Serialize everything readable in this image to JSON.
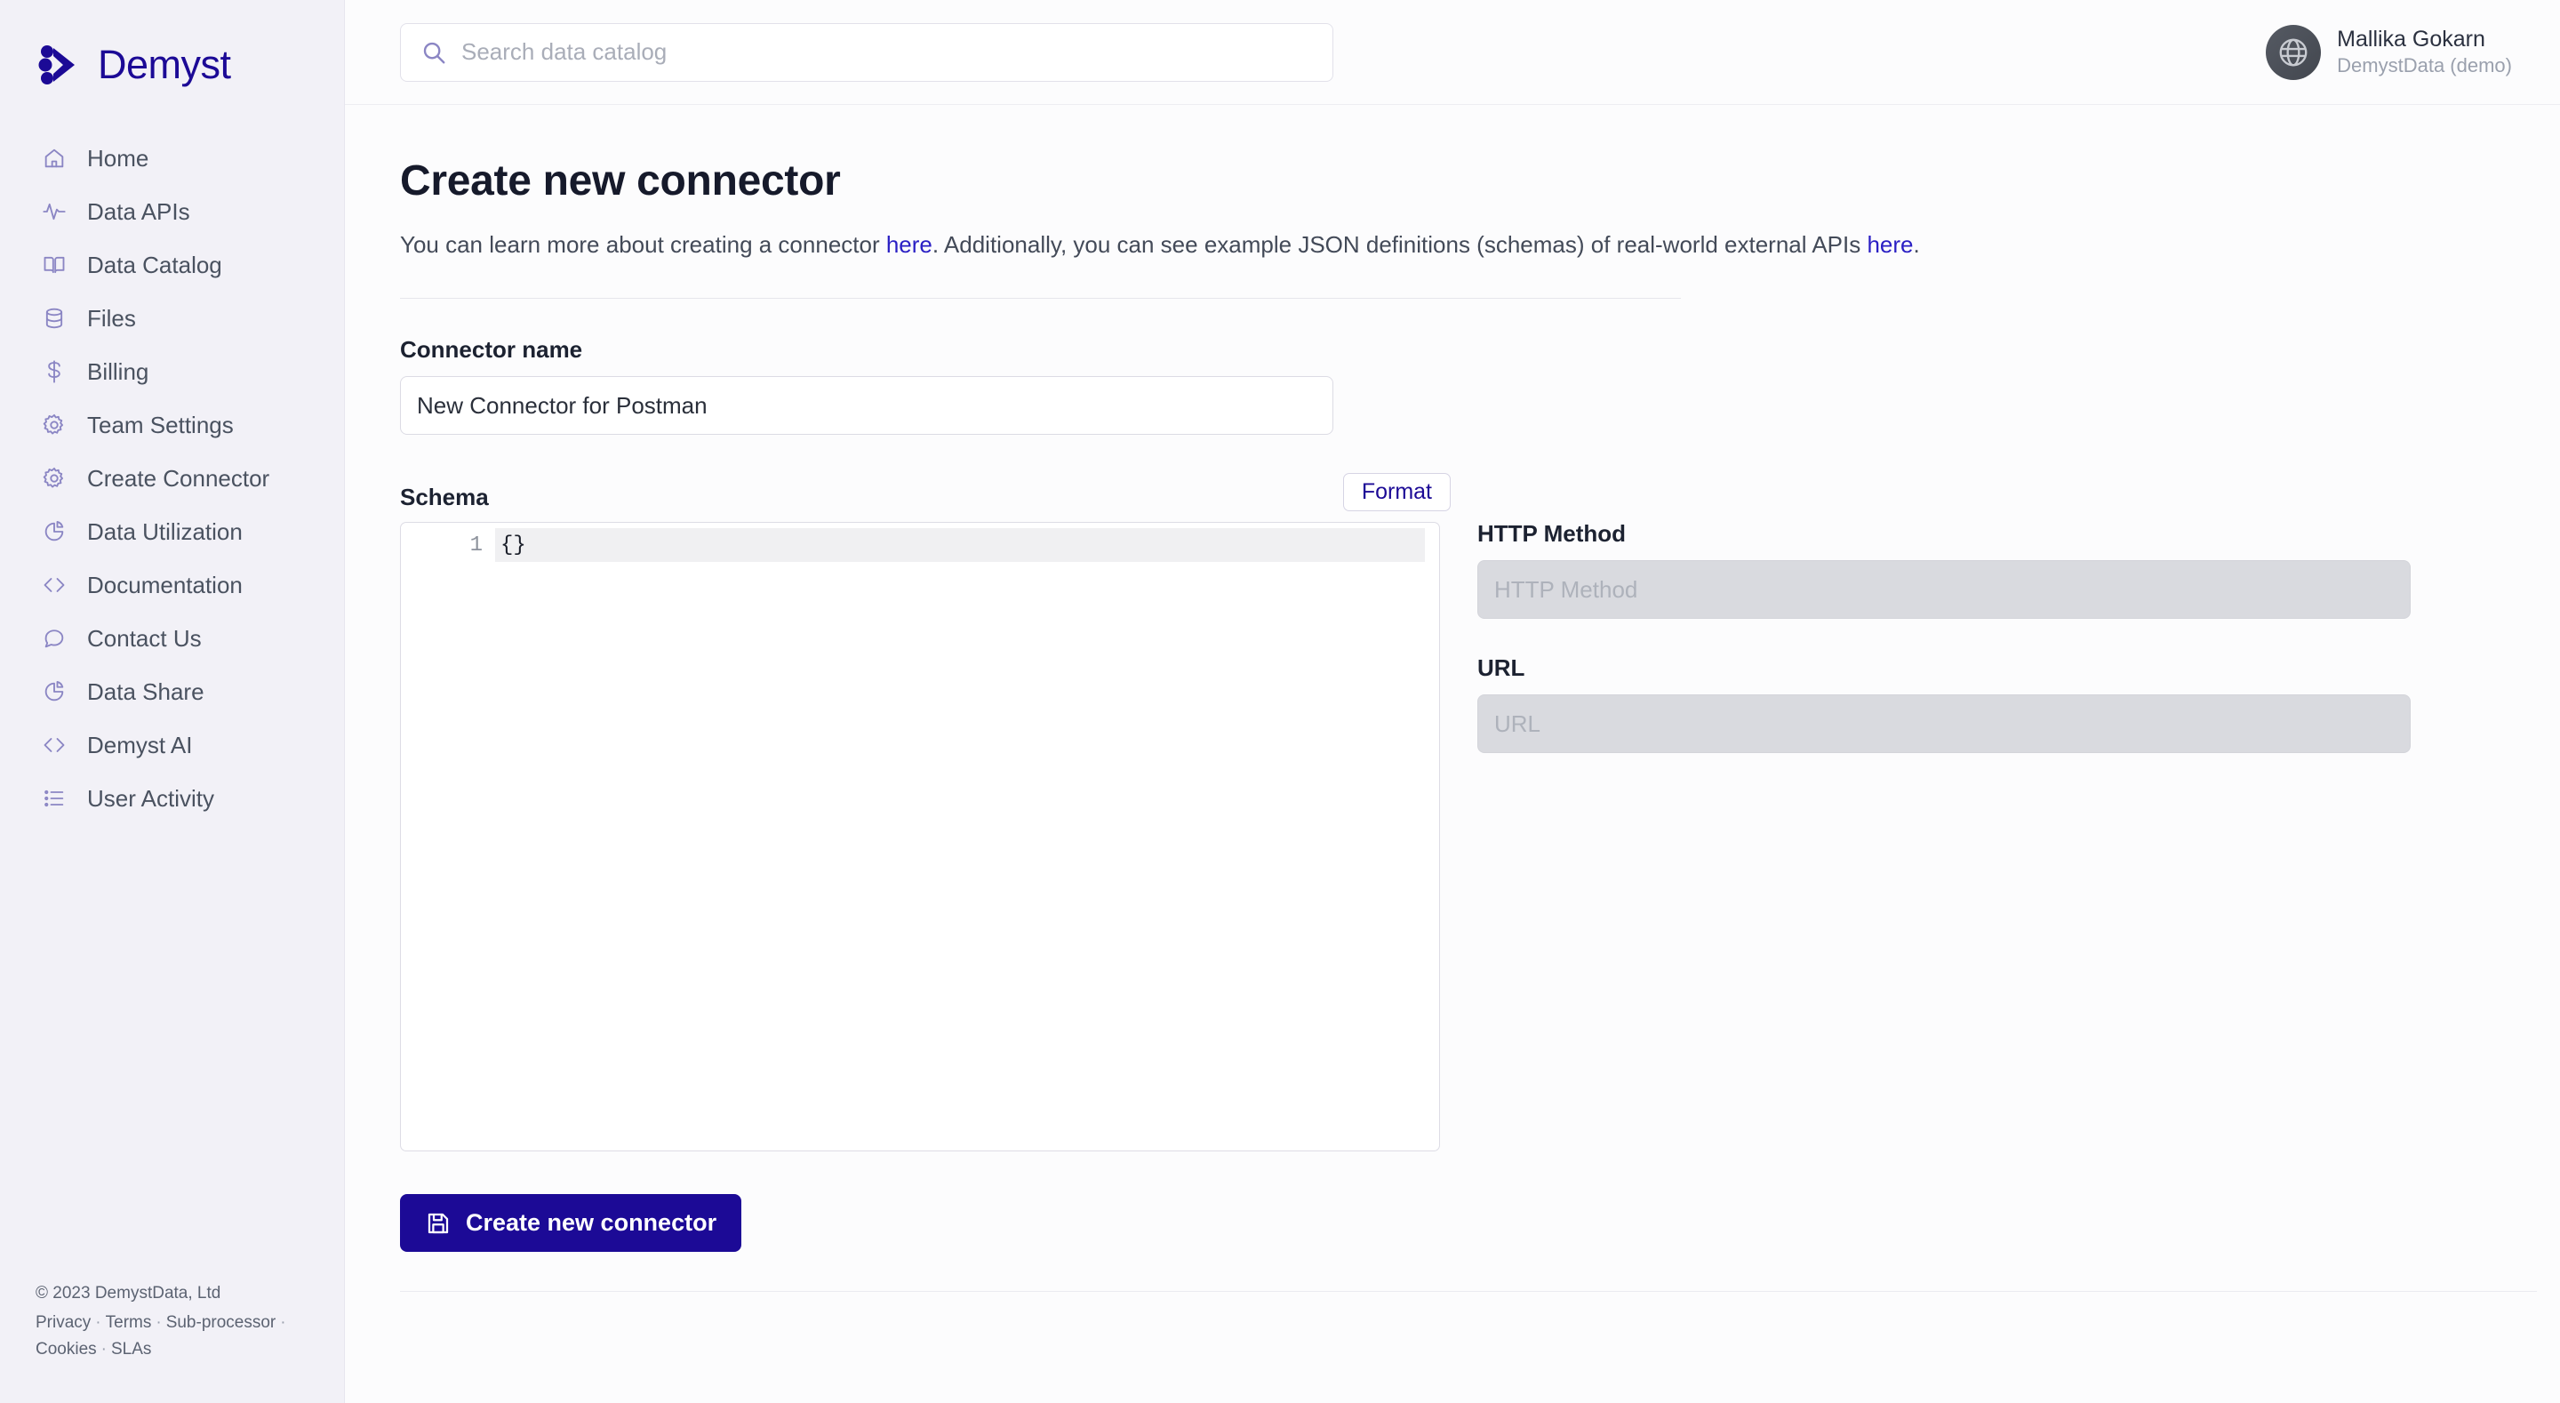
{
  "brand": {
    "name": "Demyst",
    "logo_icon": "demyst-logo-icon",
    "color": "#1c0a96"
  },
  "sidebar": {
    "items": [
      {
        "label": "Home",
        "icon": "home-icon"
      },
      {
        "label": "Data APIs",
        "icon": "activity-pulse-icon"
      },
      {
        "label": "Data Catalog",
        "icon": "book-open-icon"
      },
      {
        "label": "Files",
        "icon": "database-icon"
      },
      {
        "label": "Billing",
        "icon": "dollar-icon"
      },
      {
        "label": "Team Settings",
        "icon": "gear-icon"
      },
      {
        "label": "Create Connector",
        "icon": "gear-icon"
      },
      {
        "label": "Data Utilization",
        "icon": "pie-chart-icon"
      },
      {
        "label": "Documentation",
        "icon": "code-brackets-icon"
      },
      {
        "label": "Contact Us",
        "icon": "chat-bubble-icon"
      },
      {
        "label": "Data Share",
        "icon": "pie-chart-icon"
      },
      {
        "label": "Demyst AI",
        "icon": "code-brackets-icon"
      },
      {
        "label": "User Activity",
        "icon": "list-icon"
      }
    ],
    "footer": {
      "copyright": "© 2023 DemystData, Ltd",
      "links": [
        "Privacy",
        "Terms",
        "Sub-processor",
        "Cookies",
        "SLAs"
      ],
      "separator": "·"
    }
  },
  "topbar": {
    "search": {
      "placeholder": "Search data catalog",
      "value": "",
      "icon": "search-icon"
    },
    "user": {
      "name": "Mallika Gokarn",
      "org": "DemystData (demo)",
      "avatar_icon": "globe-icon"
    }
  },
  "page": {
    "title": "Create new connector",
    "description": {
      "part1": "You can learn more about creating a connector ",
      "link1": "here",
      "part2": ". Additionally, you can see example JSON definitions (schemas) of real-world external APIs ",
      "link2": "here",
      "part3": "."
    }
  },
  "form": {
    "connector_name": {
      "label": "Connector name",
      "value": "New Connector for Postman",
      "placeholder": "Connector name"
    },
    "schema": {
      "label": "Schema",
      "format_button": "Format",
      "lines": [
        {
          "number": "1",
          "text": "{}"
        }
      ]
    },
    "http_method": {
      "label": "HTTP Method",
      "placeholder": "HTTP Method",
      "value": "",
      "disabled": true
    },
    "url": {
      "label": "URL",
      "placeholder": "URL",
      "value": "",
      "disabled": true
    },
    "submit": {
      "label": "Create new connector",
      "icon": "save-floppy-icon",
      "color": "#1c0a96"
    }
  }
}
